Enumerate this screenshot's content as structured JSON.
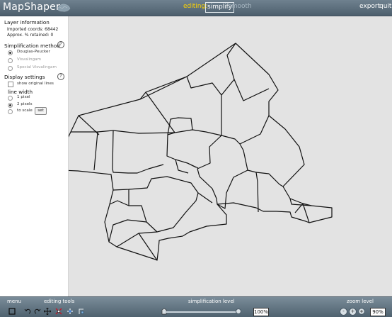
{
  "app": {
    "title": "MapShaper",
    "editing_label": "editing:",
    "mode_active": "simplify",
    "mode_inactive": "smooth",
    "export_label": "export",
    "quit_label": "quit"
  },
  "panel": {
    "layer_info": {
      "title": "Layer information",
      "imported_coords": "Imported coords: 68442",
      "retained": "Approx. % retained: 0"
    },
    "simplification": {
      "title": "Simplification method",
      "help": "?",
      "options": [
        {
          "label": "Douglas-Peucker",
          "selected": true
        },
        {
          "label": "Visvalingam",
          "selected": false
        },
        {
          "label": "Special Visvalingam",
          "selected": false
        }
      ]
    },
    "display": {
      "title": "Display settings",
      "help": "?",
      "show_original": "show original lines",
      "line_width_title": "line width",
      "line_options": [
        {
          "label": "1 pixel",
          "selected": false
        },
        {
          "label": "2 pixels",
          "selected": true
        },
        {
          "label": "to scale",
          "selected": false
        }
      ],
      "set_label": "set"
    }
  },
  "bottom": {
    "menu_label": "menu",
    "editing_tools_label": "editing tools",
    "simplification_level_label": "simplification level",
    "simplification_value": "100%",
    "zoom_level_label": "zoom level",
    "zoom_value": "90%",
    "zoom_minus": "-",
    "zoom_plus": "+"
  },
  "colors": {
    "topbar": "#5d6f7d",
    "map_background": "#e3e3e3",
    "lines": "#111111",
    "accent_yellow": "#ffd400"
  },
  "icons": [
    "globe-icon",
    "select-box-icon",
    "undo-icon",
    "redo-icon",
    "move-icon",
    "delete-vertex-icon",
    "add-vertex-icon",
    "snap-icon",
    "slider-icon",
    "zoom-out-icon",
    "zoom-in-icon",
    "fit-icon"
  ]
}
